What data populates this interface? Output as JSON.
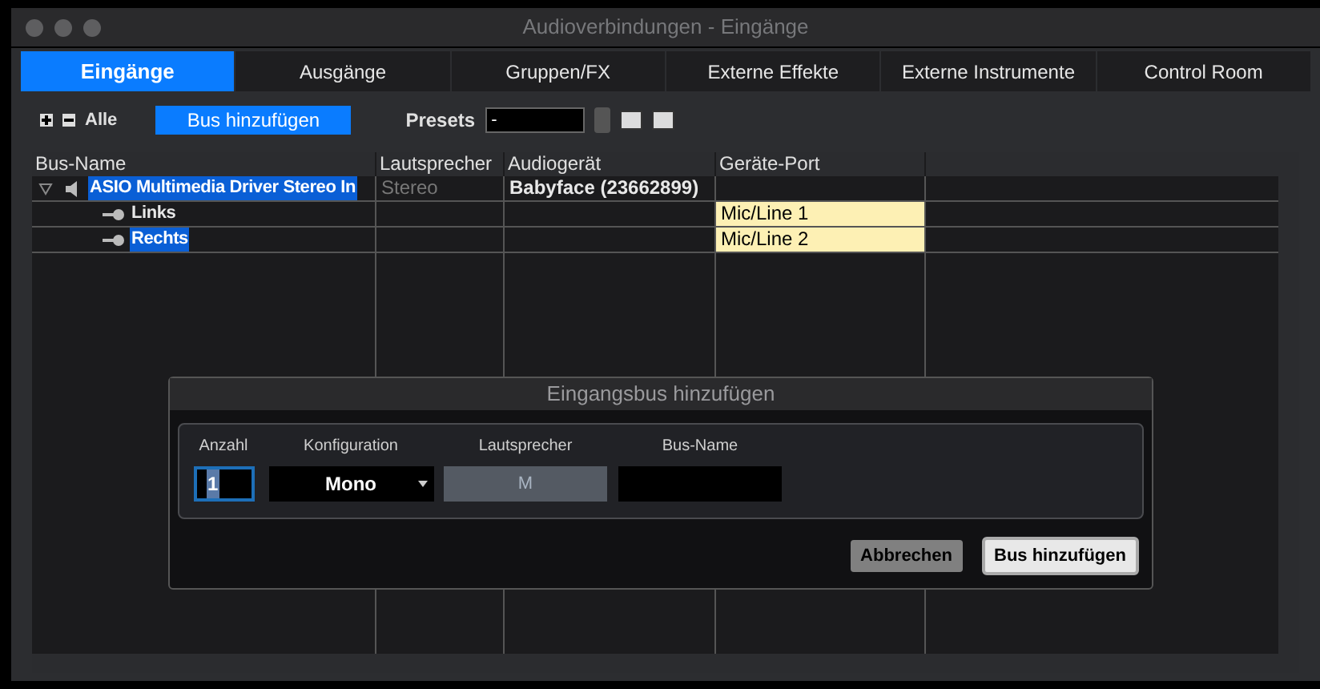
{
  "window": {
    "title": "Audioverbindungen - Eingänge"
  },
  "tabs": [
    {
      "label": "Eingänge",
      "selected": true
    },
    {
      "label": "Ausgänge",
      "selected": false
    },
    {
      "label": "Gruppen/FX",
      "selected": false
    },
    {
      "label": "Externe Effekte",
      "selected": false
    },
    {
      "label": "Externe Instrumente",
      "selected": false
    },
    {
      "label": "Control Room",
      "selected": false
    }
  ],
  "toolbar": {
    "all_label": "Alle",
    "add_bus_button": "Bus hinzufügen",
    "presets_label": "Presets",
    "presets_value": "-"
  },
  "table": {
    "columns": [
      "Bus-Name",
      "Lautsprecher",
      "Audiogerät",
      "Geräte-Port"
    ],
    "rows": [
      {
        "name": "ASIO Multimedia Driver Stereo In",
        "speaker": "Stereo",
        "device": "Babyface (23662899)",
        "selected": true,
        "expanded": true,
        "children": [
          {
            "name": "Links",
            "port": "Mic/Line 1",
            "selected": false
          },
          {
            "name": "Rechts",
            "port": "Mic/Line 2",
            "selected": true
          }
        ]
      }
    ]
  },
  "dialog": {
    "title": "Eingangsbus hinzufügen",
    "fields": [
      {
        "label": "Anzahl",
        "kind": "spinner",
        "value": "1"
      },
      {
        "label": "Konfiguration",
        "kind": "dropdown",
        "value": "Mono"
      },
      {
        "label": "Lautsprecher",
        "kind": "readonly",
        "value": "M"
      },
      {
        "label": "Bus-Name",
        "kind": "text"
      }
    ],
    "buttons": [
      {
        "label": "Abbrechen",
        "default": false
      },
      {
        "label": "Bus hinzufügen",
        "default": true
      }
    ]
  }
}
